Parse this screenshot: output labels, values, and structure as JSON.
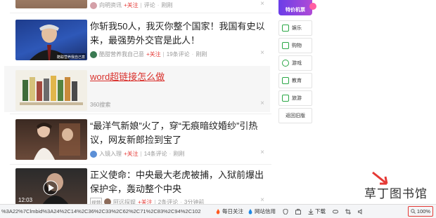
{
  "feed": {
    "items": [
      {
        "source": "向明资讯",
        "follow": "+关注",
        "comments": "评论",
        "time": "刚刚"
      },
      {
        "title": "你斩我50人，我灭你整个国家！我国有史以来，最强势外交官是此人！",
        "thumb_caption": "酷聪营养我自己意",
        "source": "酷甜营养我自己意",
        "follow": "+关注",
        "comments": "19条评论",
        "time": "刚刚"
      },
      {
        "title": "word超链接怎么做",
        "source": "360搜索"
      },
      {
        "title": "“最洋气新娘”火了，穿“无痕暗纹婚纱”引热议，网友新郎捡到宝了",
        "source": "入镜入理",
        "follow": "+关注",
        "comments": "14条评论",
        "time": "刚刚"
      },
      {
        "title": "正义使命：中央最大老虎被捕，入狱前爆出保护伞，轰动整个中央",
        "badge": "视频",
        "duration": "12:03",
        "source": "阿远探娱",
        "follow": "+关注",
        "comments": "2条评论",
        "time": "3分钟前"
      }
    ],
    "close_glyph": "×"
  },
  "sidebar": {
    "promo_label": "特价机票",
    "items": [
      {
        "label": "娱乐",
        "icon": "play-icon"
      },
      {
        "label": "购物",
        "icon": "cart-icon"
      },
      {
        "label": "游戏",
        "icon": "gamepad-icon"
      },
      {
        "label": "教育",
        "icon": "book-icon"
      },
      {
        "label": "旅游",
        "icon": "travel-icon"
      },
      {
        "label": "返回旧版",
        "icon": ""
      }
    ]
  },
  "statusbar": {
    "url": "%3A22%7Clmbid%3A24%2C14%2C36%2C33%2C62%2C71%2C83%2C94%2C102",
    "items": [
      {
        "label": "每日关注",
        "icon": "flame-icon"
      },
      {
        "label": "网站信用",
        "icon": "drop-icon"
      },
      {
        "label": "",
        "icon": "shield-icon"
      },
      {
        "label": "",
        "icon": "toolbox-icon"
      },
      {
        "label": "下载",
        "icon": "download-icon"
      },
      {
        "label": "",
        "icon": "game-icon"
      },
      {
        "label": "",
        "icon": "screenshot-icon"
      },
      {
        "label": "",
        "icon": "sound-icon"
      }
    ],
    "zoom": "100%"
  },
  "watermark": "草丁图书馆",
  "colors": {
    "accent_red": "#e53935",
    "sidebar_green": "#2aa745",
    "promo_purple": "#6a3de8"
  }
}
